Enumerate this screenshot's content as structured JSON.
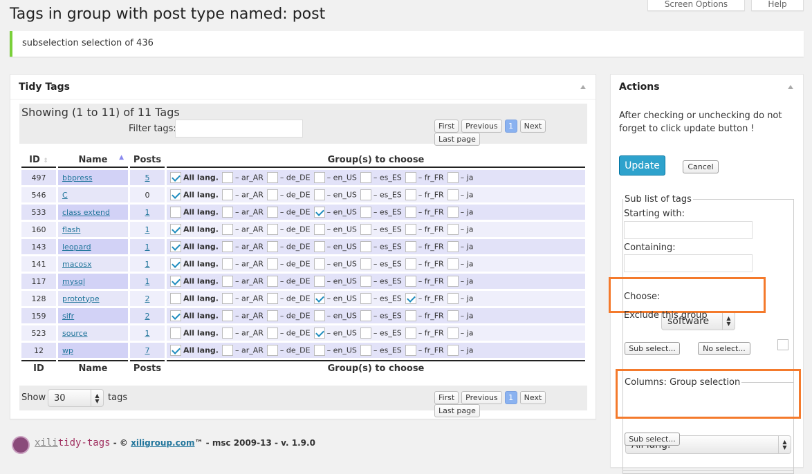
{
  "header": {
    "screen_options": "Screen Options",
    "help": "Help",
    "title": "Tags in group with post type named: post"
  },
  "notice": "subselection selection of 436",
  "tidy": {
    "title": "Tidy Tags",
    "showing": "Showing (1 to 11) of 11 Tags",
    "filter_label": "Filter tags:",
    "filter_value": "",
    "pagination": {
      "first": "First",
      "previous": "Previous",
      "current": "1",
      "next": "Next",
      "last": "Last page"
    },
    "columns": {
      "id": "ID",
      "name": "Name",
      "posts": "Posts",
      "groups": "Group(s) to choose"
    },
    "languages": [
      "All lang.",
      "– ar_AR",
      "– de_DE",
      "– en_US",
      "– es_ES",
      "– fr_FR",
      "– ja"
    ],
    "rows": [
      {
        "id": "497",
        "name": "bbpress",
        "posts": "5",
        "checked": [
          true,
          false,
          false,
          false,
          false,
          false,
          false
        ]
      },
      {
        "id": "546",
        "name": "C",
        "posts": "0",
        "checked": [
          true,
          false,
          false,
          false,
          false,
          false,
          false
        ]
      },
      {
        "id": "533",
        "name": "class extend",
        "posts": "1",
        "checked": [
          false,
          false,
          false,
          true,
          false,
          false,
          false
        ]
      },
      {
        "id": "160",
        "name": "flash",
        "posts": "1",
        "checked": [
          true,
          false,
          false,
          false,
          false,
          false,
          false
        ]
      },
      {
        "id": "143",
        "name": "leopard",
        "posts": "1",
        "checked": [
          true,
          false,
          false,
          false,
          false,
          false,
          false
        ]
      },
      {
        "id": "141",
        "name": "macosx",
        "posts": "1",
        "checked": [
          true,
          false,
          false,
          false,
          false,
          false,
          false
        ]
      },
      {
        "id": "117",
        "name": "mysql",
        "posts": "1",
        "checked": [
          true,
          false,
          false,
          false,
          false,
          false,
          false
        ]
      },
      {
        "id": "128",
        "name": "prototype",
        "posts": "2",
        "checked": [
          false,
          false,
          false,
          true,
          false,
          true,
          false
        ]
      },
      {
        "id": "159",
        "name": "sifr",
        "posts": "2",
        "checked": [
          true,
          false,
          false,
          false,
          false,
          false,
          false
        ]
      },
      {
        "id": "523",
        "name": "source",
        "posts": "1",
        "checked": [
          false,
          false,
          false,
          true,
          false,
          false,
          false
        ]
      },
      {
        "id": "12",
        "name": "wp",
        "posts": "7",
        "checked": [
          true,
          false,
          false,
          false,
          false,
          false,
          false
        ]
      }
    ],
    "show_label": "Show",
    "show_value": "30",
    "tags_label": "tags"
  },
  "footer": {
    "logo_a": "xili",
    "logo_b": "tidy-tags",
    "copy": " - © ",
    "link": "xiligroup.com",
    "rest": "™ - msc 2009-13 - v. 1.9.0"
  },
  "actions": {
    "title": "Actions",
    "hint": "After checking or unchecking do not forget to click update button !",
    "update": "Update",
    "cancel": "Cancel",
    "sublist_legend": "Sub list of tags",
    "starting_label": "Starting with:",
    "starting_value": "",
    "containing_label": "Containing:",
    "containing_value": "",
    "choose_label": "Choose:",
    "choose_value": "software",
    "exclude_label": "Exclude this group",
    "sub_select": "Sub select...",
    "no_select": "No select...",
    "columns_legend": "Columns: Group selection",
    "columns_value": "All lang.",
    "sub_select2": "Sub select..."
  },
  "colors": {
    "accent": "#2ea2cc",
    "highlight": "#f47a2c",
    "notice": "#7ad03a"
  }
}
